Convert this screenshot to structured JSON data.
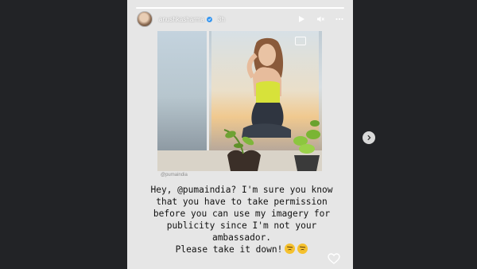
{
  "story": {
    "username": "anushkasharma",
    "time_ago": "3h",
    "progress": 1.0,
    "icons": {
      "verified": "verified-badge-icon",
      "play": "play-icon",
      "mute": "volume-muted-icon",
      "more": "more-options-icon",
      "like": "heart-icon",
      "next": "chevron-right-icon"
    }
  },
  "post": {
    "watermark": "@pumaindia",
    "caption": "Hey, @pumaindia?  I'm sure you know that you have to take permission before you can use my imagery for publicity since I'm not your ambassador.\nPlease take it down!",
    "emoji": [
      "angry-face",
      "angry-face"
    ]
  },
  "colors": {
    "page_bg": "#222326",
    "story_bg": "#e6e6e6",
    "verified": "#3897f0",
    "emoji": "#f5c12e"
  }
}
